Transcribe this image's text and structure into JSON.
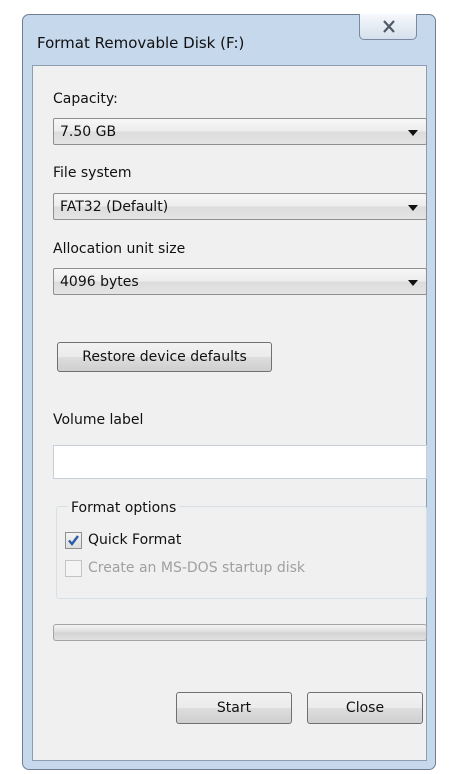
{
  "window": {
    "title": "Format Removable Disk (F:)"
  },
  "capacity": {
    "label": "Capacity:",
    "value": "7.50 GB"
  },
  "file_system": {
    "label": "File system",
    "value": "FAT32 (Default)"
  },
  "allocation": {
    "label": "Allocation unit size",
    "value": "4096 bytes"
  },
  "restore_button": {
    "label": "Restore device defaults"
  },
  "volume_label": {
    "label": "Volume label",
    "value": ""
  },
  "format_options": {
    "title": "Format options",
    "quick_format": {
      "label": "Quick Format",
      "checked": true,
      "enabled": true
    },
    "msdos_startup": {
      "label": "Create an MS-DOS startup disk",
      "checked": false,
      "enabled": false
    }
  },
  "progress": {
    "value": 0
  },
  "buttons": {
    "start": "Start",
    "close": "Close"
  },
  "colors": {
    "check_accent": "#2a5aa8",
    "disabled_text": "#a0a0a0"
  },
  "icons": {
    "close": "close-icon",
    "dropdown": "chevron-down-icon",
    "check": "check-icon"
  }
}
